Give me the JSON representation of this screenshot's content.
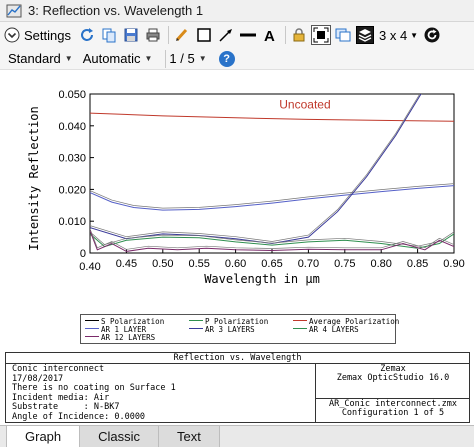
{
  "window": {
    "title": "3: Reflection vs. Wavelength 1"
  },
  "toolbar": {
    "settings_label": "Settings",
    "layout_label": "3 x 4"
  },
  "subtoolbar": {
    "standard": "Standard",
    "automatic": "Automatic",
    "page": "1 / 5"
  },
  "chart_data": {
    "type": "line",
    "title": "",
    "xlabel": "Wavelength in µm",
    "ylabel": "Intensity Reflection",
    "xlim": [
      0.4,
      0.9
    ],
    "ylim": [
      0,
      0.05
    ],
    "x_ticks": [
      "0.40",
      "0.45",
      "0.50",
      "0.55",
      "0.60",
      "0.65",
      "0.70",
      "0.75",
      "0.80",
      "0.85",
      "0.90"
    ],
    "y_ticks": [
      "0",
      "0.010",
      "0.020",
      "0.030",
      "0.040",
      "0.050"
    ],
    "annotation": "Uncoated",
    "grid": false,
    "series": [
      {
        "name": "Uncoated",
        "color": "#c0392b",
        "x": [
          0.4,
          0.5,
          0.6,
          0.7,
          0.8,
          0.9
        ],
        "y": [
          0.044,
          0.0431,
          0.0425,
          0.042,
          0.0417,
          0.0414
        ]
      },
      {
        "name": "AR 1 LAYER",
        "color": "#5560c8",
        "x": [
          0.4,
          0.43,
          0.46,
          0.5,
          0.55,
          0.6,
          0.65,
          0.7,
          0.75,
          0.8,
          0.85,
          0.9
        ],
        "y": [
          0.019,
          0.016,
          0.0143,
          0.0135,
          0.0137,
          0.0146,
          0.0157,
          0.017,
          0.0182,
          0.0193,
          0.0203,
          0.0212
        ]
      },
      {
        "name": "AR 3 LAYERS",
        "color": "#3a3a9a",
        "x": [
          0.4,
          0.45,
          0.5,
          0.55,
          0.6,
          0.65,
          0.7,
          0.74,
          0.78,
          0.82,
          0.86
        ],
        "y": [
          0.008,
          0.0045,
          0.006,
          0.0055,
          0.0045,
          0.003,
          0.005,
          0.013,
          0.024,
          0.037,
          0.052
        ]
      },
      {
        "name": "AR 4 LAYERS",
        "color": "#2f8f4f",
        "x": [
          0.4,
          0.42,
          0.45,
          0.5,
          0.55,
          0.6,
          0.65,
          0.7,
          0.75,
          0.8,
          0.85,
          0.88,
          0.9
        ],
        "y": [
          0.006,
          0.002,
          0.004,
          0.005,
          0.0048,
          0.0035,
          0.0025,
          0.0035,
          0.004,
          0.003,
          0.0015,
          0.003,
          0.006
        ]
      },
      {
        "name": "AR 12 LAYERS",
        "color": "#7a2a6a",
        "x": [
          0.4,
          0.41,
          0.43,
          0.45,
          0.48,
          0.52,
          0.56,
          0.6,
          0.65,
          0.7,
          0.75,
          0.8,
          0.83,
          0.86,
          0.88,
          0.9
        ],
        "y": [
          0.007,
          0.001,
          0.003,
          0.0005,
          0.0015,
          0.001,
          0.0015,
          0.001,
          0.0008,
          0.0012,
          0.001,
          0.001,
          0.003,
          0.001,
          0.004,
          0.002
        ]
      }
    ]
  },
  "legend": {
    "items": [
      {
        "label": "S Polarization",
        "color": "#000000"
      },
      {
        "label": "P Polarization",
        "color": "#2f8f4f"
      },
      {
        "label": "Average Polarization",
        "color": "#c0392b"
      },
      {
        "label": "AR 1 LAYER",
        "color": "#5560c8"
      },
      {
        "label": "AR 3 LAYERS",
        "color": "#3a3a9a"
      },
      {
        "label": "AR 4 LAYERS",
        "color": "#2f8f4f"
      },
      {
        "label": "AR 12 LAYERS",
        "color": "#7a2a6a"
      }
    ]
  },
  "info": {
    "title": "Reflection vs. Wavelength",
    "left_lines": "Conic interconnect\n17/08/2017\nThere is no coating on Surface 1\nIncident media: Air\nSubstrate     : N-BK7\nAngle of Incidence: 0.0000",
    "right_1": "Zemax",
    "right_2": "Zemax OpticStudio 16.0",
    "right_3": "AR_Conic interconnect.zmx",
    "right_4": "Configuration 1 of 5"
  },
  "tabs": {
    "graph": "Graph",
    "classic": "Classic",
    "text": "Text"
  }
}
